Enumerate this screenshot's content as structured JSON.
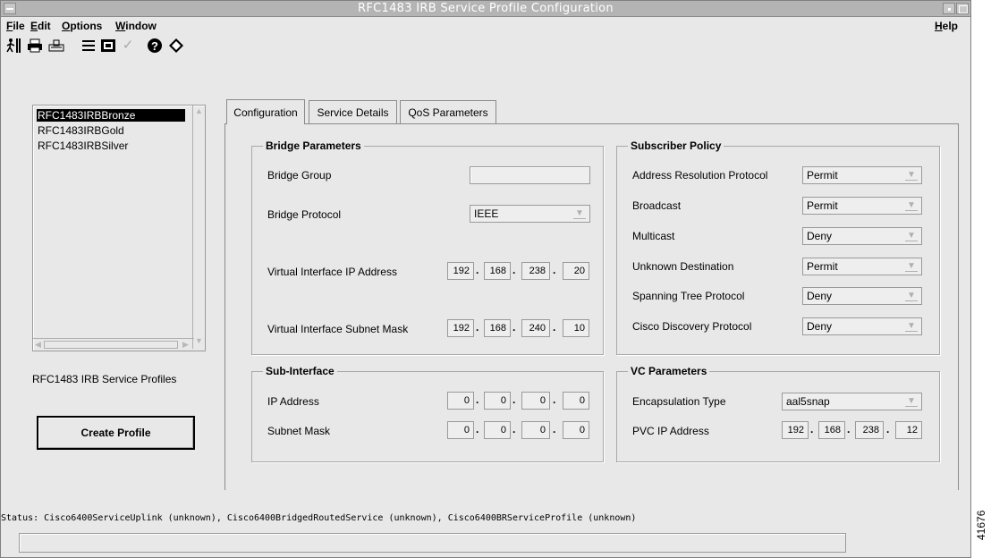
{
  "window": {
    "title": "RFC1483 IRB Service Profile Configuration"
  },
  "menu": {
    "file": "File",
    "edit": "Edit",
    "options": "Options",
    "window": "Window",
    "help": "Help"
  },
  "toolbar": {
    "icons": [
      "exit-icon",
      "print-icon",
      "print-preview-icon",
      "list-icon",
      "properties-icon",
      "check-icon",
      "help-icon",
      "diamond-icon"
    ]
  },
  "profiles": {
    "items": [
      "RFC1483IRBBronze",
      "RFC1483IRBGold",
      "RFC1483IRBSilver"
    ],
    "selected": "RFC1483IRBBronze",
    "label": "RFC1483 IRB Service Profiles",
    "create_button": "Create Profile"
  },
  "tabs": [
    "Configuration",
    "Service Details",
    "QoS Parameters"
  ],
  "active_tab": "Configuration",
  "bridge": {
    "title": "Bridge Parameters",
    "group_label": "Bridge Group",
    "group_value": "",
    "protocol_label": "Bridge Protocol",
    "protocol_value": "IEEE",
    "vi_ip_label": "Virtual Interface IP Address",
    "vi_ip": [
      "192",
      "168",
      "238",
      "20"
    ],
    "vi_mask_label": "Virtual Interface Subnet Mask",
    "vi_mask": [
      "192",
      "168",
      "240",
      "10"
    ]
  },
  "subscriber": {
    "title": "Subscriber Policy",
    "rows": [
      {
        "label": "Address Resolution Protocol",
        "value": "Permit"
      },
      {
        "label": "Broadcast",
        "value": "Permit"
      },
      {
        "label": "Multicast",
        "value": "Deny"
      },
      {
        "label": "Unknown Destination",
        "value": "Permit"
      },
      {
        "label": "Spanning Tree Protocol",
        "value": "Deny"
      },
      {
        "label": "Cisco Discovery Protocol",
        "value": "Deny"
      }
    ]
  },
  "subif": {
    "title": "Sub-Interface",
    "ip_label": "IP Address",
    "ip": [
      "0",
      "0",
      "0",
      "0"
    ],
    "mask_label": "Subnet Mask",
    "mask": [
      "0",
      "0",
      "0",
      "0"
    ]
  },
  "vc": {
    "title": "VC Parameters",
    "encap_label": "Encapsulation Type",
    "encap_value": "aal5snap",
    "pvc_label": "PVC IP Address",
    "pvc_ip": [
      "192",
      "168",
      "238",
      "12"
    ]
  },
  "status": {
    "text": "Status: Cisco6400ServiceUplink (unknown), Cisco6400BridgedRoutedService (unknown), Cisco6400BRServiceProfile (unknown)"
  },
  "figure_number": "41676"
}
